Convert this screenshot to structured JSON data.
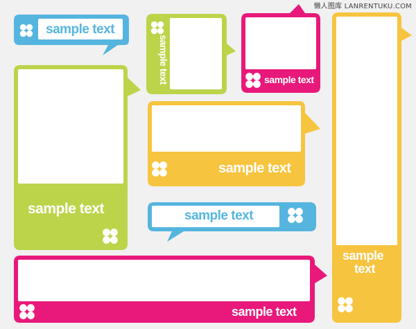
{
  "watermark": "懒人图库 LANRENTUKU.COM",
  "colors": {
    "blue": "#55b5df",
    "green": "#bcd44a",
    "pink": "#e8197a",
    "yellow": "#f7c43f",
    "background": "#f1f1f1"
  },
  "frames": [
    {
      "id": "blue-top-left",
      "color": "blue",
      "text": "sample text"
    },
    {
      "id": "green-small-vertical",
      "color": "green",
      "text": "sample text"
    },
    {
      "id": "pink-small",
      "color": "pink",
      "text": "sample text"
    },
    {
      "id": "yellow-tall-right",
      "color": "yellow",
      "text_line1": "sample",
      "text_line2": "text"
    },
    {
      "id": "green-large",
      "color": "green",
      "text": "sample text"
    },
    {
      "id": "yellow-medium",
      "color": "yellow",
      "text": "sample text"
    },
    {
      "id": "blue-middle",
      "color": "blue",
      "text": "sample text"
    },
    {
      "id": "pink-wide-bottom",
      "color": "pink",
      "text": "sample text"
    }
  ]
}
